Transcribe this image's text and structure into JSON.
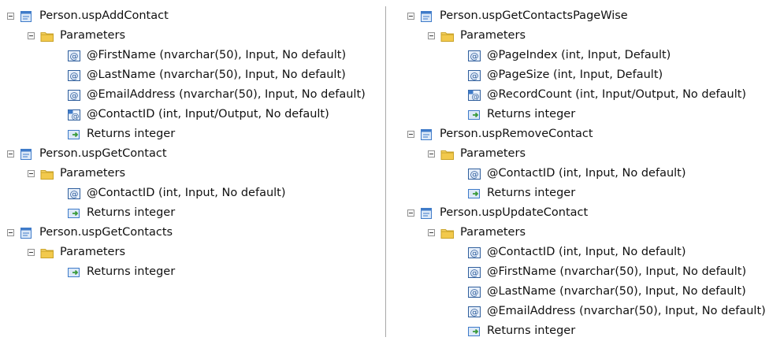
{
  "left": {
    "procedures": [
      {
        "name": "Person.uspAddContact",
        "folder": "Parameters",
        "params": [
          {
            "text": "@FirstName (nvarchar(50), Input, No default)",
            "icon": "input-parameter-icon"
          },
          {
            "text": "@LastName (nvarchar(50), Input, No default)",
            "icon": "input-parameter-icon"
          },
          {
            "text": "@EmailAddress (nvarchar(50), Input, No default)",
            "icon": "input-parameter-icon"
          },
          {
            "text": "@ContactID (int, Input/Output, No default)",
            "icon": "output-parameter-icon"
          }
        ],
        "returns": "Returns integer"
      },
      {
        "name": "Person.uspGetContact",
        "folder": "Parameters",
        "params": [
          {
            "text": "@ContactID (int, Input, No default)",
            "icon": "input-parameter-icon"
          }
        ],
        "returns": "Returns integer"
      },
      {
        "name": "Person.uspGetContacts",
        "folder": "Parameters",
        "params": [],
        "returns": "Returns integer"
      }
    ]
  },
  "right": {
    "procedures": [
      {
        "name": "Person.uspGetContactsPageWise",
        "folder": "Parameters",
        "params": [
          {
            "text": "@PageIndex (int, Input, Default)",
            "icon": "input-parameter-icon"
          },
          {
            "text": "@PageSize (int, Input, Default)",
            "icon": "input-parameter-icon"
          },
          {
            "text": "@RecordCount (int, Input/Output, No default)",
            "icon": "output-parameter-icon"
          }
        ],
        "returns": "Returns integer"
      },
      {
        "name": "Person.uspRemoveContact",
        "folder": "Parameters",
        "params": [
          {
            "text": "@ContactID (int, Input, No default)",
            "icon": "input-parameter-icon"
          }
        ],
        "returns": "Returns integer"
      },
      {
        "name": "Person.uspUpdateContact",
        "folder": "Parameters",
        "params": [
          {
            "text": "@ContactID (int, Input, No default)",
            "icon": "input-parameter-icon"
          },
          {
            "text": "@FirstName (nvarchar(50), Input, No default)",
            "icon": "input-parameter-icon"
          },
          {
            "text": "@LastName (nvarchar(50), Input, No default)",
            "icon": "input-parameter-icon"
          },
          {
            "text": "@EmailAddress (nvarchar(50), Input, No default)",
            "icon": "input-parameter-icon"
          }
        ],
        "returns": "Returns integer"
      }
    ]
  },
  "colors": {
    "text": "#111111",
    "divider": "#a8a8a8",
    "folder": "#f2c94c",
    "procedure_icon": "#3f7bc9",
    "parameter_icon": "#2f5e9c",
    "returns_arrow": "#3a9a3a"
  }
}
